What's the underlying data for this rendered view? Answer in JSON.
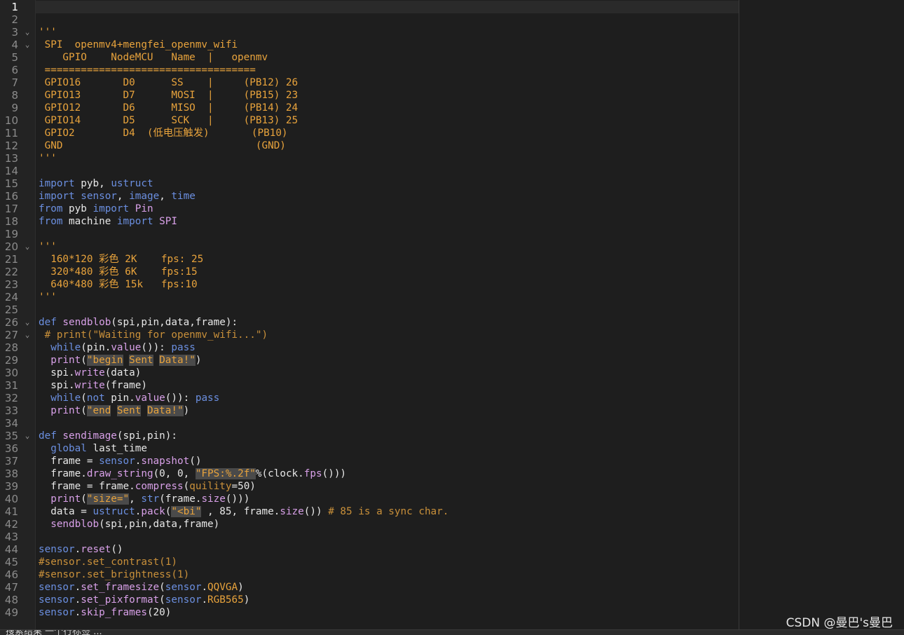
{
  "editor": {
    "current_line": 1,
    "watermark": "CSDN @曼巴's曼巴",
    "status_text": "搜索结果 一个行标签 ..."
  },
  "lines": [
    {
      "n": "1",
      "fold": false,
      "segs": []
    },
    {
      "n": "2",
      "fold": false,
      "segs": []
    },
    {
      "n": "3",
      "fold": true,
      "segs": [
        {
          "t": "'''",
          "c": "str"
        }
      ]
    },
    {
      "n": "4",
      "fold": true,
      "segs": [
        {
          "t": " SPI  openmv4+mengfei_openmv_wifi",
          "c": "str"
        }
      ]
    },
    {
      "n": "5",
      "fold": false,
      "segs": [
        {
          "t": "    GPIO    NodeMCU   Name  |   openmv",
          "c": "str"
        }
      ]
    },
    {
      "n": "6",
      "fold": false,
      "segs": [
        {
          "t": " ===================================",
          "c": "str"
        }
      ]
    },
    {
      "n": "7",
      "fold": false,
      "segs": [
        {
          "t": " GPIO16       D0      SS    |     (PB12) 26",
          "c": "str"
        }
      ]
    },
    {
      "n": "8",
      "fold": false,
      "segs": [
        {
          "t": " GPIO13       D7      MOSI  |     (PB15) 23",
          "c": "str"
        }
      ]
    },
    {
      "n": "9",
      "fold": false,
      "segs": [
        {
          "t": " GPIO12       D6      MISO  |     (PB14) 24",
          "c": "str"
        }
      ]
    },
    {
      "n": "10",
      "fold": false,
      "segs": [
        {
          "t": " GPIO14       D5      SCK   |     (PB13) 25",
          "c": "str"
        }
      ]
    },
    {
      "n": "11",
      "fold": false,
      "segs": [
        {
          "t": " GPIO2        D4  (低电压触发)       (PB10)",
          "c": "str"
        }
      ]
    },
    {
      "n": "12",
      "fold": false,
      "segs": [
        {
          "t": " GND                                (GND)",
          "c": "str"
        }
      ]
    },
    {
      "n": "13",
      "fold": false,
      "segs": [
        {
          "t": "'''",
          "c": "str"
        }
      ]
    },
    {
      "n": "14",
      "fold": false,
      "segs": []
    },
    {
      "n": "15",
      "fold": false,
      "segs": [
        {
          "t": "import",
          "c": "kw"
        },
        {
          "t": " pyb, ",
          "c": "txt"
        },
        {
          "t": "ustruct",
          "c": "kw"
        }
      ]
    },
    {
      "n": "16",
      "fold": false,
      "segs": [
        {
          "t": "import",
          "c": "kw"
        },
        {
          "t": " ",
          "c": "txt"
        },
        {
          "t": "sensor",
          "c": "kw"
        },
        {
          "t": ", ",
          "c": "txt"
        },
        {
          "t": "image",
          "c": "kw"
        },
        {
          "t": ", ",
          "c": "txt"
        },
        {
          "t": "time",
          "c": "kw"
        }
      ]
    },
    {
      "n": "17",
      "fold": false,
      "segs": [
        {
          "t": "from",
          "c": "kw"
        },
        {
          "t": " pyb ",
          "c": "txt"
        },
        {
          "t": "import",
          "c": "kw"
        },
        {
          "t": " Pin",
          "c": "fn"
        }
      ]
    },
    {
      "n": "18",
      "fold": false,
      "segs": [
        {
          "t": "from",
          "c": "kw"
        },
        {
          "t": " machine ",
          "c": "txt"
        },
        {
          "t": "import",
          "c": "kw"
        },
        {
          "t": " SPI",
          "c": "fn"
        }
      ]
    },
    {
      "n": "19",
      "fold": false,
      "segs": []
    },
    {
      "n": "20",
      "fold": true,
      "segs": [
        {
          "t": "'''",
          "c": "str"
        }
      ]
    },
    {
      "n": "21",
      "fold": false,
      "segs": [
        {
          "t": "  160*120 彩色 2K    fps: 25",
          "c": "str"
        }
      ]
    },
    {
      "n": "22",
      "fold": false,
      "segs": [
        {
          "t": "  320*480 彩色 6K    fps:15",
          "c": "str"
        }
      ]
    },
    {
      "n": "23",
      "fold": false,
      "segs": [
        {
          "t": "  640*480 彩色 15k   fps:10",
          "c": "str"
        }
      ]
    },
    {
      "n": "24",
      "fold": false,
      "segs": [
        {
          "t": "'''",
          "c": "str"
        }
      ]
    },
    {
      "n": "25",
      "fold": false,
      "segs": []
    },
    {
      "n": "26",
      "fold": true,
      "segs": [
        {
          "t": "def",
          "c": "kw"
        },
        {
          "t": " sendblob",
          "c": "fn"
        },
        {
          "t": "(spi,pin,data,frame):",
          "c": "txt"
        }
      ]
    },
    {
      "n": "27",
      "fold": true,
      "segs": [
        {
          "t": " # print(\"Waiting for openmv_wifi...\")",
          "c": "cmt"
        }
      ]
    },
    {
      "n": "28",
      "fold": false,
      "segs": [
        {
          "t": "  ",
          "c": "txt"
        },
        {
          "t": "while",
          "c": "kw"
        },
        {
          "t": "(pin.",
          "c": "txt"
        },
        {
          "t": "value",
          "c": "fn"
        },
        {
          "t": "()): ",
          "c": "txt"
        },
        {
          "t": "pass",
          "c": "kw"
        }
      ]
    },
    {
      "n": "29",
      "fold": false,
      "segs": [
        {
          "t": "  ",
          "c": "txt"
        },
        {
          "t": "print",
          "c": "fn"
        },
        {
          "t": "(",
          "c": "txt"
        },
        {
          "t": "\"begin",
          "c": "str",
          "h": true
        },
        {
          "t": " ",
          "c": "str"
        },
        {
          "t": "Sent",
          "c": "str",
          "h": true
        },
        {
          "t": " ",
          "c": "str"
        },
        {
          "t": "Data!\"",
          "c": "str",
          "h": true
        },
        {
          "t": ")",
          "c": "txt"
        }
      ]
    },
    {
      "n": "30",
      "fold": false,
      "segs": [
        {
          "t": "  spi.",
          "c": "txt"
        },
        {
          "t": "write",
          "c": "fn"
        },
        {
          "t": "(data)",
          "c": "txt"
        }
      ]
    },
    {
      "n": "31",
      "fold": false,
      "segs": [
        {
          "t": "  spi.",
          "c": "txt"
        },
        {
          "t": "write",
          "c": "fn"
        },
        {
          "t": "(frame)",
          "c": "txt"
        }
      ]
    },
    {
      "n": "32",
      "fold": false,
      "segs": [
        {
          "t": "  ",
          "c": "txt"
        },
        {
          "t": "while",
          "c": "kw"
        },
        {
          "t": "(",
          "c": "txt"
        },
        {
          "t": "not",
          "c": "kw"
        },
        {
          "t": " pin.",
          "c": "txt"
        },
        {
          "t": "value",
          "c": "fn"
        },
        {
          "t": "()): ",
          "c": "txt"
        },
        {
          "t": "pass",
          "c": "kw"
        }
      ]
    },
    {
      "n": "33",
      "fold": false,
      "segs": [
        {
          "t": "  ",
          "c": "txt"
        },
        {
          "t": "print",
          "c": "fn"
        },
        {
          "t": "(",
          "c": "txt"
        },
        {
          "t": "\"end",
          "c": "str",
          "h": true
        },
        {
          "t": " ",
          "c": "str"
        },
        {
          "t": "Sent",
          "c": "str",
          "h": true
        },
        {
          "t": " ",
          "c": "str"
        },
        {
          "t": "Data!\"",
          "c": "str",
          "h": true
        },
        {
          "t": ")",
          "c": "txt"
        }
      ]
    },
    {
      "n": "34",
      "fold": false,
      "segs": []
    },
    {
      "n": "35",
      "fold": true,
      "segs": [
        {
          "t": "def",
          "c": "kw"
        },
        {
          "t": " sendimage",
          "c": "fn"
        },
        {
          "t": "(spi,pin):",
          "c": "txt"
        }
      ]
    },
    {
      "n": "36",
      "fold": false,
      "segs": [
        {
          "t": "  ",
          "c": "txt"
        },
        {
          "t": "global",
          "c": "kw"
        },
        {
          "t": " last_time",
          "c": "txt"
        }
      ]
    },
    {
      "n": "37",
      "fold": false,
      "segs": [
        {
          "t": "  frame = ",
          "c": "txt"
        },
        {
          "t": "sensor",
          "c": "kw"
        },
        {
          "t": ".",
          "c": "txt"
        },
        {
          "t": "snapshot",
          "c": "fn"
        },
        {
          "t": "()",
          "c": "txt"
        }
      ]
    },
    {
      "n": "38",
      "fold": false,
      "segs": [
        {
          "t": "  frame.",
          "c": "txt"
        },
        {
          "t": "draw_string",
          "c": "fn"
        },
        {
          "t": "(0, 0, ",
          "c": "txt"
        },
        {
          "t": "\"FPS:%.2f\"",
          "c": "str",
          "h": true
        },
        {
          "t": "%(clock.",
          "c": "txt"
        },
        {
          "t": "fps",
          "c": "fn"
        },
        {
          "t": "()))",
          "c": "txt"
        }
      ]
    },
    {
      "n": "39",
      "fold": false,
      "segs": [
        {
          "t": "  frame = frame.",
          "c": "txt"
        },
        {
          "t": "compress",
          "c": "fn"
        },
        {
          "t": "(",
          "c": "txt"
        },
        {
          "t": "quility",
          "c": "cmt"
        },
        {
          "t": "=50)",
          "c": "txt"
        }
      ]
    },
    {
      "n": "40",
      "fold": false,
      "segs": [
        {
          "t": "  ",
          "c": "txt"
        },
        {
          "t": "print",
          "c": "fn"
        },
        {
          "t": "(",
          "c": "txt"
        },
        {
          "t": "\"size=\"",
          "c": "str",
          "h": true
        },
        {
          "t": ", ",
          "c": "txt"
        },
        {
          "t": "str",
          "c": "kw"
        },
        {
          "t": "(frame.",
          "c": "txt"
        },
        {
          "t": "size",
          "c": "fn"
        },
        {
          "t": "()))",
          "c": "txt"
        }
      ]
    },
    {
      "n": "41",
      "fold": false,
      "segs": [
        {
          "t": "  data = ",
          "c": "txt"
        },
        {
          "t": "ustruct",
          "c": "kw"
        },
        {
          "t": ".",
          "c": "txt"
        },
        {
          "t": "pack",
          "c": "fn"
        },
        {
          "t": "(",
          "c": "txt"
        },
        {
          "t": "\"<bi\"",
          "c": "str",
          "h": true
        },
        {
          "t": " , 85, frame.",
          "c": "txt"
        },
        {
          "t": "size",
          "c": "fn"
        },
        {
          "t": "()) ",
          "c": "txt"
        },
        {
          "t": "# 85 is a sync char.",
          "c": "cmt"
        }
      ]
    },
    {
      "n": "42",
      "fold": false,
      "segs": [
        {
          "t": "  ",
          "c": "txt"
        },
        {
          "t": "sendblob",
          "c": "fn"
        },
        {
          "t": "(spi,pin,data,frame)",
          "c": "txt"
        }
      ]
    },
    {
      "n": "43",
      "fold": false,
      "segs": []
    },
    {
      "n": "44",
      "fold": false,
      "segs": [
        {
          "t": "sensor",
          "c": "kw"
        },
        {
          "t": ".",
          "c": "txt"
        },
        {
          "t": "reset",
          "c": "fn"
        },
        {
          "t": "()",
          "c": "txt"
        }
      ]
    },
    {
      "n": "45",
      "fold": false,
      "segs": [
        {
          "t": "#sensor.set_contrast(1)",
          "c": "cmt"
        }
      ]
    },
    {
      "n": "46",
      "fold": false,
      "segs": [
        {
          "t": "#sensor.set_brightness(1)",
          "c": "cmt"
        }
      ]
    },
    {
      "n": "47",
      "fold": false,
      "segs": [
        {
          "t": "sensor",
          "c": "kw"
        },
        {
          "t": ".",
          "c": "txt"
        },
        {
          "t": "set_framesize",
          "c": "fn"
        },
        {
          "t": "(",
          "c": "txt"
        },
        {
          "t": "sensor",
          "c": "kw"
        },
        {
          "t": ".",
          "c": "txt"
        },
        {
          "t": "QQVGA",
          "c": "str"
        },
        {
          "t": ")",
          "c": "txt"
        }
      ]
    },
    {
      "n": "48",
      "fold": false,
      "segs": [
        {
          "t": "sensor",
          "c": "kw"
        },
        {
          "t": ".",
          "c": "txt"
        },
        {
          "t": "set_pixformat",
          "c": "fn"
        },
        {
          "t": "(",
          "c": "txt"
        },
        {
          "t": "sensor",
          "c": "kw"
        },
        {
          "t": ".",
          "c": "txt"
        },
        {
          "t": "RGB565",
          "c": "str"
        },
        {
          "t": ")",
          "c": "txt"
        }
      ]
    },
    {
      "n": "49",
      "fold": false,
      "segs": [
        {
          "t": "sensor",
          "c": "kw"
        },
        {
          "t": ".",
          "c": "txt"
        },
        {
          "t": "skip_frames",
          "c": "fn"
        },
        {
          "t": "(20)",
          "c": "txt"
        }
      ]
    }
  ]
}
